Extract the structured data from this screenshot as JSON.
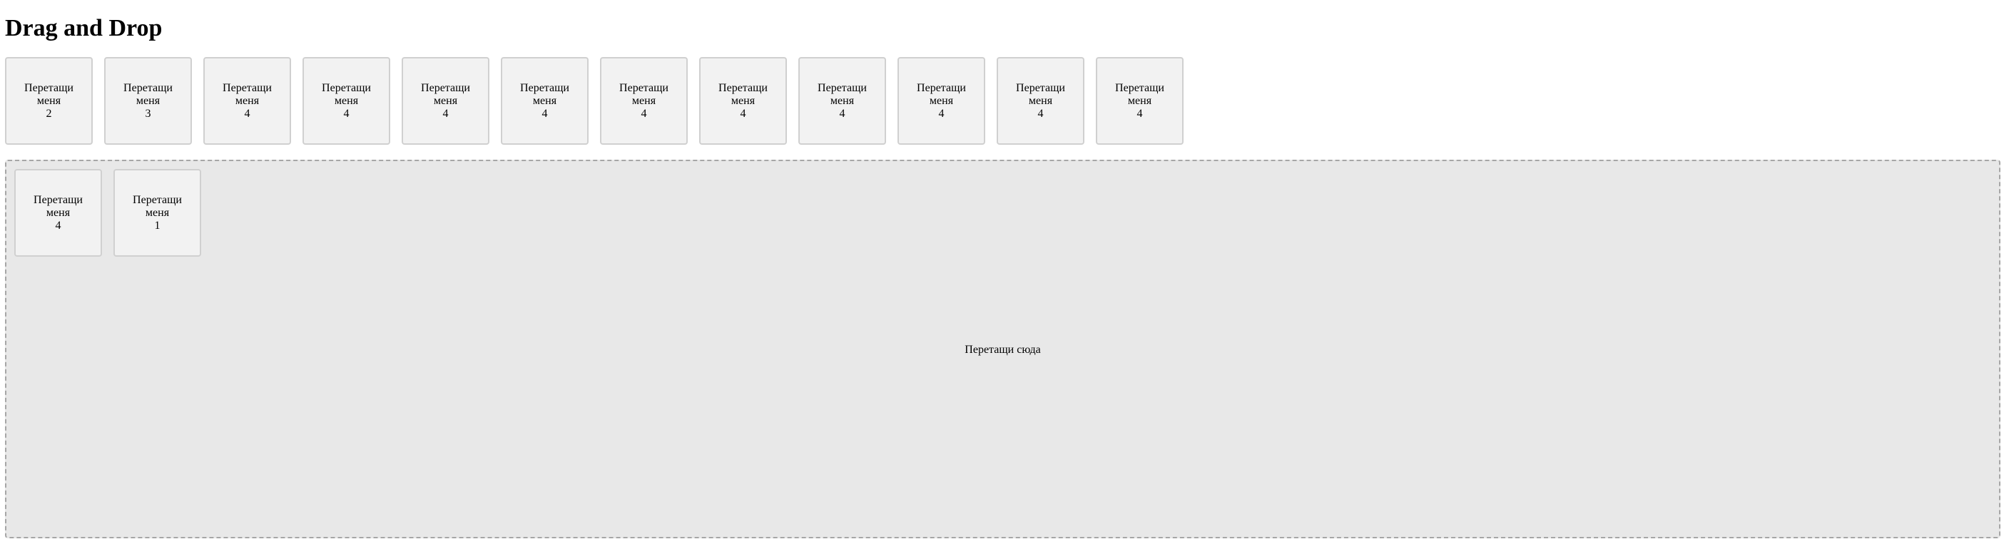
{
  "page": {
    "title": "Drag and Drop"
  },
  "source_items": [
    {
      "label": "Перетащи меня 2"
    },
    {
      "label": "Перетащи меня 3"
    },
    {
      "label": "Перетащи меня 4"
    },
    {
      "label": "Перетащи меня 4"
    },
    {
      "label": "Перетащи меня 4"
    },
    {
      "label": "Перетащи меня 4"
    },
    {
      "label": "Перетащи меня 4"
    },
    {
      "label": "Перетащи меня 4"
    },
    {
      "label": "Перетащи меня 4"
    },
    {
      "label": "Перетащи меня 4"
    },
    {
      "label": "Перетащи меня 4"
    },
    {
      "label": "Перетащи меня 4"
    }
  ],
  "drop_zone": {
    "label": "Перетащи сюда",
    "items": [
      {
        "label": "Перетащи меня 4"
      },
      {
        "label": "Перетащи меня 1"
      }
    ]
  },
  "colors": {
    "item_background": "#f2f2f2",
    "item_border": "#d0d0d0",
    "zone_background": "#e8e8e8",
    "zone_border": "#a6a6a6"
  }
}
